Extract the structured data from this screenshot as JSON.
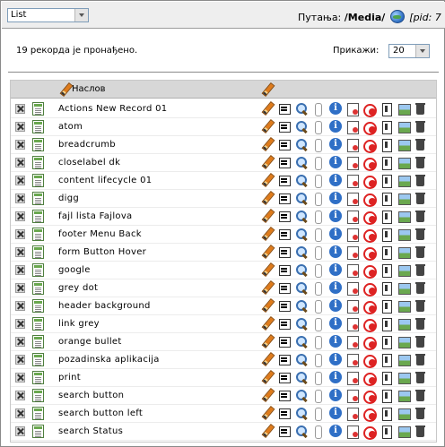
{
  "topbar": {
    "view_selected": "List",
    "path_label": "Путања:",
    "path_value": "/Media/",
    "pid_text": "[pid: 7"
  },
  "summary": {
    "count_text": "19 рекорда је пронађено.",
    "show_label": "Прикажи:",
    "show_value": "20"
  },
  "table": {
    "title_header": "Наслов",
    "rows": [
      {
        "title": "Actions New Record 01"
      },
      {
        "title": "atom"
      },
      {
        "title": "breadcrumb"
      },
      {
        "title": "closelabel dk"
      },
      {
        "title": "content lifecycle 01"
      },
      {
        "title": "digg"
      },
      {
        "title": "fajl lista Fajlova"
      },
      {
        "title": "footer Menu Back"
      },
      {
        "title": "form Button Hover"
      },
      {
        "title": "google"
      },
      {
        "title": "grey dot"
      },
      {
        "title": "header background"
      },
      {
        "title": "link grey"
      },
      {
        "title": "orange bullet"
      },
      {
        "title": "pozadinska aplikacija"
      },
      {
        "title": "print"
      },
      {
        "title": "search button"
      },
      {
        "title": "search button left"
      },
      {
        "title": "search Status"
      }
    ],
    "row_actions": [
      "edit-icon",
      "move-icon",
      "zoom-icon",
      "attachment-icon",
      "info-icon",
      "history-icon",
      "disable-icon",
      "permissions-icon",
      "image-icon",
      "delete-icon"
    ]
  }
}
